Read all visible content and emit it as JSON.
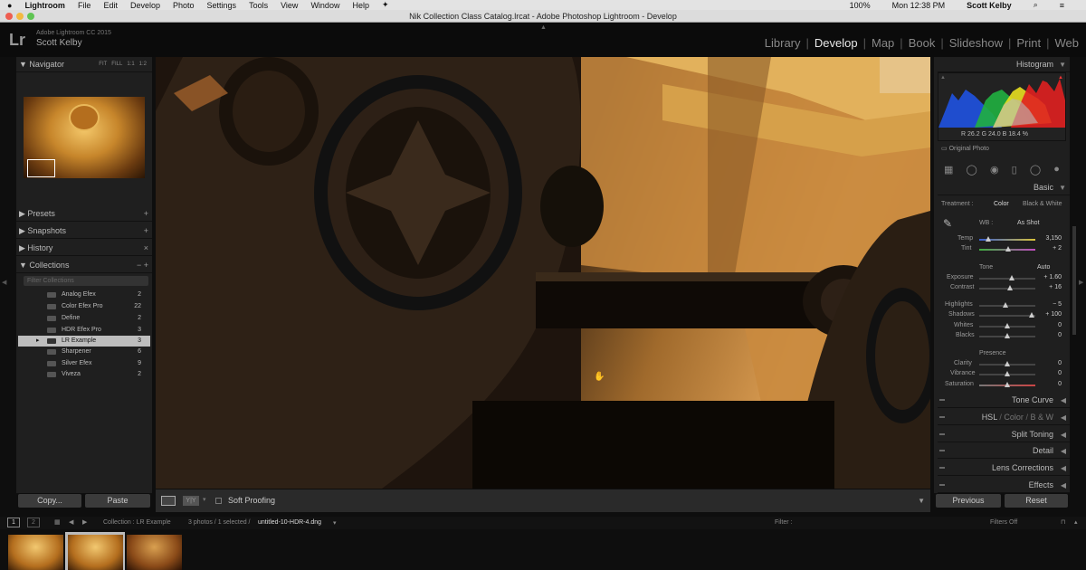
{
  "menubar": {
    "apple": "",
    "items": [
      "Lightroom",
      "File",
      "Edit",
      "Develop",
      "Photo",
      "Settings",
      "Tools",
      "View",
      "Window",
      "Help"
    ],
    "status": [
      "100%",
      "Mon 12:38 PM",
      "Scott Kelby"
    ]
  },
  "window": {
    "title": "Nik Collection Class Catalog.lrcat - Adobe Photoshop Lightroom - Develop"
  },
  "identity": {
    "logo": "Lr",
    "version": "Adobe Lightroom CC 2015",
    "user": "Scott Kelby"
  },
  "modules": {
    "items": [
      "Library",
      "Develop",
      "Map",
      "Book",
      "Slideshow",
      "Print",
      "Web"
    ],
    "sep": "|",
    "active": "Develop"
  },
  "left": {
    "navigator": {
      "title": "Navigator",
      "options": [
        "FIT",
        "FILL",
        "1:1",
        "1:2"
      ]
    },
    "presets": "Presets",
    "snapshots": "Snapshots",
    "history": "History",
    "collections": "Collections",
    "collections_search": "Filter Collections",
    "collection_items": [
      {
        "name": "Analog Efex",
        "count": "2"
      },
      {
        "name": "Color Efex Pro",
        "count": "22"
      },
      {
        "name": "Define",
        "count": "2"
      },
      {
        "name": "HDR Efex Pro",
        "count": "3"
      },
      {
        "name": "LR Example",
        "count": "3"
      },
      {
        "name": "Sharpener",
        "count": "6"
      },
      {
        "name": "Silver Efex",
        "count": "9"
      },
      {
        "name": "Viveza",
        "count": "2"
      }
    ],
    "copy": "Copy...",
    "paste": "Paste",
    "plus": "+",
    "close": "×",
    "minus": "−"
  },
  "toolbar": {
    "soft_proofing": "Soft Proofing",
    "yy": "Y|Y"
  },
  "right": {
    "histogram": "Histogram",
    "readout": {
      "r_label": "R",
      "r": "26.2",
      "g_label": "G",
      "g": "24.0",
      "b_label": "B",
      "b": "18.4",
      "unit": "%"
    },
    "original_photo": "Original Photo",
    "basic": "Basic",
    "treatment_label": "Treatment :",
    "treatment_color": "Color",
    "treatment_bw": "Black & White",
    "wb_label": "WB :",
    "wb_value": "As Shot",
    "temp": {
      "label": "Temp",
      "value": "3,150"
    },
    "tint": {
      "label": "Tint",
      "value": "+ 2"
    },
    "tone": "Tone",
    "auto": "Auto",
    "exposure": {
      "label": "Exposure",
      "value": "+ 1.60"
    },
    "contrast": {
      "label": "Contrast",
      "value": "+ 16"
    },
    "highlights": {
      "label": "Highlights",
      "value": "− 5"
    },
    "shadows": {
      "label": "Shadows",
      "value": "+ 100"
    },
    "whites": {
      "label": "Whites",
      "value": "0"
    },
    "blacks": {
      "label": "Blacks",
      "value": "0"
    },
    "presence": "Presence",
    "clarity": {
      "label": "Clarity",
      "value": "0"
    },
    "vibrance": {
      "label": "Vibrance",
      "value": "0"
    },
    "saturation": {
      "label": "Saturation",
      "value": "0"
    },
    "tone_curve": "Tone Curve",
    "hsl": "HSL",
    "hsl_color": "Color",
    "hsl_bw": "B & W",
    "hsl_sep": "/",
    "split_toning": "Split Toning",
    "detail": "Detail",
    "lens_corrections": "Lens Corrections",
    "effects": "Effects",
    "previous": "Previous",
    "reset": "Reset"
  },
  "filmbar": {
    "page1": "1",
    "page2": "2",
    "collection": "Collection : LR Example",
    "count": "3 photos / 1 selected /",
    "filename": "untitled-10-HDR-4.dng",
    "filter": "Filter :",
    "filters_off": "Filters Off"
  },
  "colors": {
    "bg": "#0e0e0e",
    "panel": "#1f1f1f",
    "active_module": "#e8e8e8"
  }
}
